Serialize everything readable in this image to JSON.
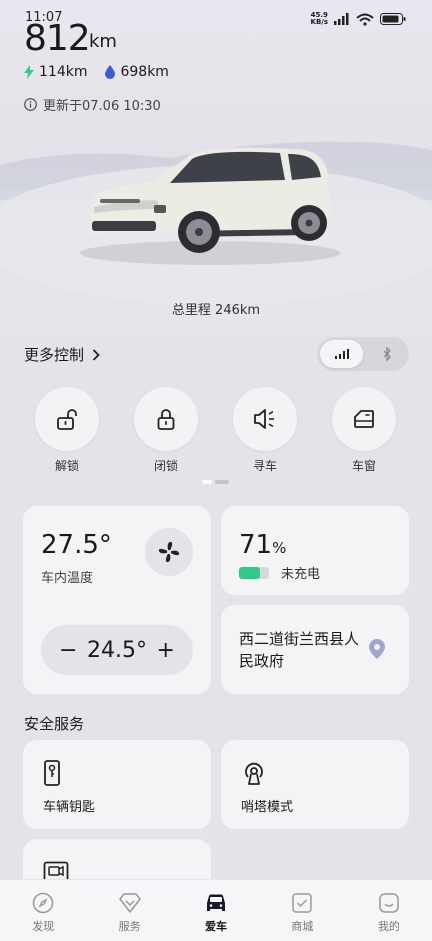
{
  "status_bar": {
    "time": "11:07",
    "net_speed_value": "45.9",
    "net_speed_unit": "KB/s",
    "network": "HD"
  },
  "hero": {
    "range_value": "812",
    "range_unit": "km",
    "electric_range": "114km",
    "fuel_range": "698km",
    "update_text": "更新于07.06 10:30",
    "mileage": "总里程 246km"
  },
  "more_controls": {
    "label": "更多控制"
  },
  "controls": [
    {
      "label": "解锁",
      "icon": "unlock-icon"
    },
    {
      "label": "闭锁",
      "icon": "lock-icon"
    },
    {
      "label": "寻车",
      "icon": "horn-icon"
    },
    {
      "label": "车窗",
      "icon": "window-icon"
    }
  ],
  "climate": {
    "cabin_temp": "27.5°",
    "cabin_temp_label": "车内温度",
    "setpoint": "24.5°",
    "minus": "−",
    "plus": "+"
  },
  "battery": {
    "level": "71",
    "unit": "%",
    "status": "未充电",
    "fraction": 0.71
  },
  "location": {
    "address": "西二道街兰西县人民政府"
  },
  "safety": {
    "title": "安全服务",
    "items": [
      {
        "label": "车辆钥匙",
        "icon": "car-key-icon"
      },
      {
        "label": "哨塔模式",
        "icon": "sentry-icon"
      }
    ]
  },
  "bottom_nav": [
    {
      "label": "发现",
      "icon": "compass-icon"
    },
    {
      "label": "服务",
      "icon": "service-icon"
    },
    {
      "label": "爱车",
      "icon": "car-icon"
    },
    {
      "label": "商城",
      "icon": "shop-icon"
    },
    {
      "label": "我的",
      "icon": "profile-icon"
    }
  ],
  "colors": {
    "electric": "#2fcb8a",
    "fuel": "#3d5bd6",
    "background": "#e3e4e8",
    "card": "#f4f4f6"
  }
}
